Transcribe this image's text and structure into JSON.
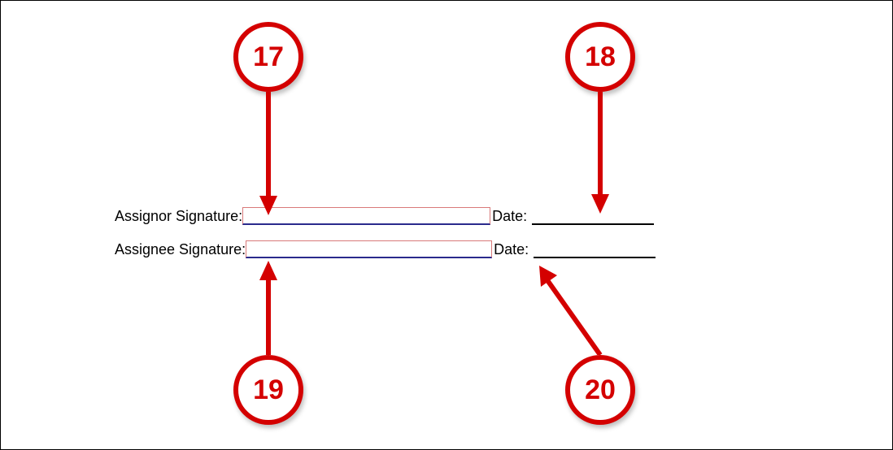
{
  "form": {
    "row1": {
      "label": "Assignor Signature:",
      "dateLabel": "Date:"
    },
    "row2": {
      "label": "Assignee Signature:",
      "dateLabel": "Date:"
    }
  },
  "callouts": {
    "c17": "17",
    "c18": "18",
    "c19": "19",
    "c20": "20"
  },
  "colors": {
    "calloutRed": "#d40000",
    "inputBorder": "#d97a7a",
    "inputUnderline": "#2a2a8c"
  }
}
